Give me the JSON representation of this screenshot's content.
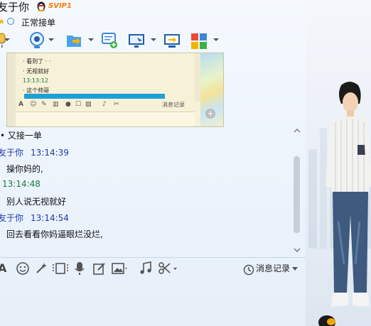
{
  "window": {
    "title": "友于你",
    "vip_badge": "SVIP1",
    "status": "正常接单"
  },
  "toolbar": {
    "items": [
      {
        "icon": "microphone-icon"
      },
      {
        "icon": "camera-icon"
      },
      {
        "icon": "folder-transfer-icon"
      },
      {
        "icon": "new-chat-icon"
      },
      {
        "icon": "remote-screen-icon"
      },
      {
        "icon": "share-screen-icon"
      },
      {
        "icon": "apps-icon"
      }
    ]
  },
  "screenshot": {
    "lines": [
      {
        "text": "· 看到了 · ·",
        "time": false
      },
      {
        "text": "· 无视就好",
        "time": false
      },
      {
        "text": "13:13:12",
        "time": true
      },
      {
        "text": "· 这个帅哥",
        "time": false
      }
    ],
    "history_label": "消息记录"
  },
  "messages": [
    {
      "kind": "text",
      "text": "• 又接一单"
    },
    {
      "kind": "header",
      "sender": "友于你",
      "time": "13:14:39"
    },
    {
      "kind": "text",
      "text": "操你妈的,"
    },
    {
      "kind": "time_only",
      "time": "13:14:48"
    },
    {
      "kind": "text",
      "text": "别人说无视就好"
    },
    {
      "kind": "header",
      "sender": "友于你",
      "time": "13:14:54"
    },
    {
      "kind": "text",
      "text": "回去看看你妈逼眼烂没烂,"
    }
  ],
  "bottom_toolbar": {
    "history_label": "消息记录"
  },
  "colors": {
    "sender": "#1f3ca8",
    "timestamp_green": "#1a7a3a",
    "accent_blue": "#1e9fd6"
  }
}
